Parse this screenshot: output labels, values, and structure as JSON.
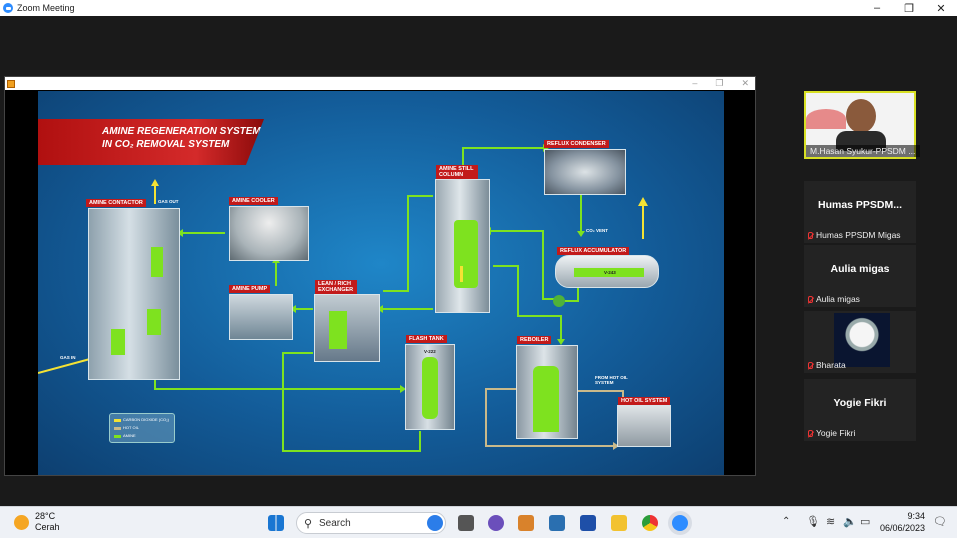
{
  "window": {
    "title": "Zoom Meeting",
    "controls": [
      "–",
      "❐",
      "✕"
    ]
  },
  "share": {
    "controls": [
      "–",
      "❐",
      "✕"
    ]
  },
  "slide": {
    "banner_line1": "AMINE REGENERATION SYSTEM",
    "banner_line2": "IN CO₂ REMOVAL SYSTEM",
    "labels": {
      "contactor": "AMINE CONTACTOR",
      "gas_out": "GAS OUT",
      "gas_in": "GAS IN",
      "cooler": "AMINE COOLER",
      "pump": "AMINE PUMP",
      "exchanger": "LEAN / RICH EXCHANGER",
      "still": "AMINE STILL COLUMN",
      "condenser": "REFLUX CONDENSER",
      "co2_vent": "CO₂ VENT",
      "accumulator": "REFLUX ACCUMULATOR",
      "v243": "V-243",
      "flash": "FLASH TANK",
      "v222": "V-222",
      "reboiler": "REBOILER",
      "from_hot_oil": "FROM HOT OIL SYSTEM",
      "hot_oil": "HOT OIL SYSTEM"
    },
    "legend": [
      "CARBON DIOXIDE (CO₂)",
      "HOT OIL",
      "AMINE"
    ],
    "colors": {
      "amine": "#7ee21f",
      "co2": "#f4e234",
      "hot_oil": "#c9b98a",
      "label_red": "#c21a1a"
    }
  },
  "participants": [
    {
      "name": "M.Hasan Syukur-PPSDM ...",
      "video": true
    },
    {
      "display": "Humas PPSDM...",
      "name": "Humas PPSDM Migas",
      "muted": true
    },
    {
      "display": "Aulia migas",
      "name": "Aulia migas",
      "muted": true
    },
    {
      "name": "Bharata",
      "avatar": "astronaut",
      "muted": true
    },
    {
      "display": "Yogie Fikri",
      "name": "Yogie Fikri",
      "muted": true
    }
  ],
  "taskbar": {
    "weather_temp": "28°C",
    "weather_desc": "Cerah",
    "search_placeholder": "Search",
    "time": "9:34",
    "date": "06/06/2023"
  }
}
